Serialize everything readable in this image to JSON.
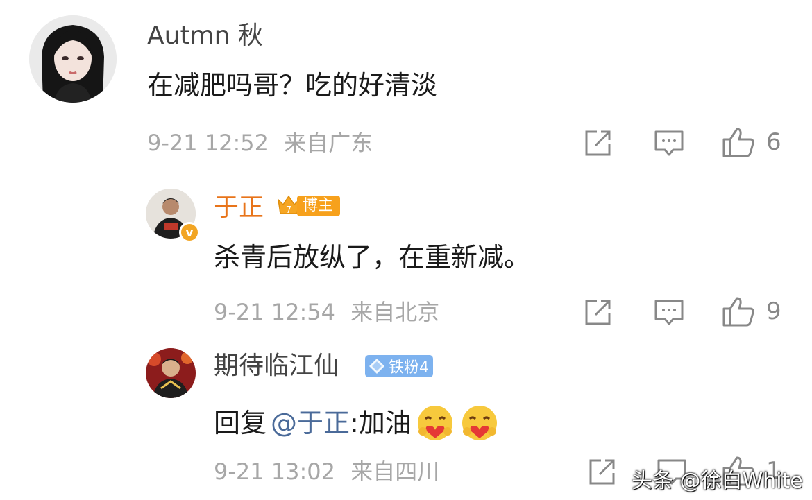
{
  "comments": [
    {
      "author": "Autmn 秋",
      "text": "在减肥吗哥？吃的好清淡",
      "time": "9-21 12:52",
      "location": "来自广东",
      "likes": "6"
    },
    {
      "author": "于正",
      "badge_text": "博主",
      "badge_level": "7",
      "verified_mark": "v",
      "text": "杀青后放纵了，在重新减。",
      "time": "9-21 12:54",
      "location": "来自北京",
      "likes": "9"
    },
    {
      "author": "期待临江仙",
      "badge_text": "铁粉4",
      "reply_prefix": "回复",
      "reply_mention": "@于正",
      "reply_text": ":加油",
      "time": "9-21 13:02",
      "location": "来自四川",
      "likes": "1"
    }
  ],
  "watermark": "头条 @徐白White",
  "icons": [
    "share-icon",
    "comment-icon",
    "like-icon",
    "hug-emoji"
  ],
  "colors": {
    "author_orange": "#e8741a",
    "blogger_badge": "#f7a11c",
    "fan_badge": "#7db2ef",
    "mention": "#4a6a99",
    "meta": "#a7a7a7"
  }
}
